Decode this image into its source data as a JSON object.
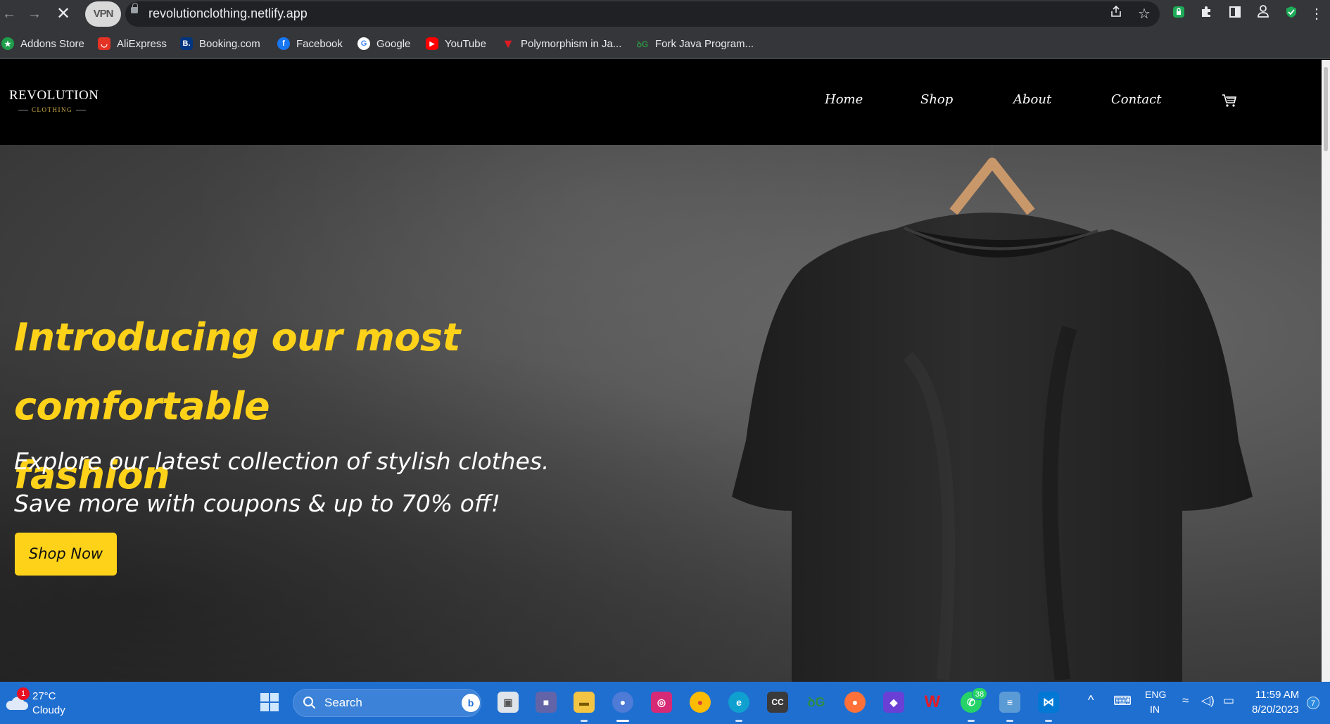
{
  "browser": {
    "url": "revolutionclothing.netlify.app",
    "vpn_label": "VPN",
    "bookmarks": [
      {
        "label": "Addons Store",
        "icon": "addons-store-icon"
      },
      {
        "label": "AliExpress",
        "icon": "aliexpress-icon"
      },
      {
        "label": "Booking.com",
        "icon": "booking-icon"
      },
      {
        "label": "Facebook",
        "icon": "facebook-icon"
      },
      {
        "label": "Google",
        "icon": "google-icon"
      },
      {
        "label": "YouTube",
        "icon": "youtube-icon"
      },
      {
        "label": "Polymorphism in Ja...",
        "icon": "polymorphism-icon"
      },
      {
        "label": "Fork Java Program...",
        "icon": "geeksforgeeks-icon"
      }
    ]
  },
  "site": {
    "logo": {
      "name": "REVOLUTION",
      "sub": "CLOTHING"
    },
    "nav": [
      {
        "label": "Home"
      },
      {
        "label": "Shop"
      },
      {
        "label": "About"
      },
      {
        "label": "Contact"
      }
    ],
    "hero": {
      "title_line1": "Introducing our most comfortable",
      "title_line2": "fashion",
      "sub_line1": "Explore our latest collection of stylish clothes.",
      "sub_line2": "Save more with coupons & up to 70% off!",
      "button": "Shop Now"
    },
    "colors": {
      "accent": "#ffd21a",
      "header_bg": "#000000"
    }
  },
  "taskbar": {
    "weather": {
      "temp": "27°C",
      "condition": "Cloudy",
      "alert_count": "1"
    },
    "search_label": "Search",
    "whatsapp_count": "38",
    "language": {
      "lang": "ENG",
      "region": "IN"
    },
    "time": "11:59 AM",
    "date": "8/20/2023",
    "notification_count": "7"
  }
}
